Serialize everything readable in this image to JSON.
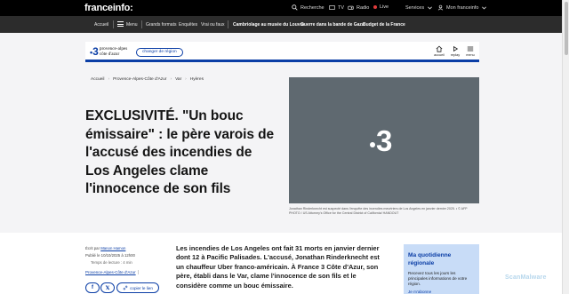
{
  "topbar": {
    "logo": "franceinfo:",
    "search_label": "Recherche",
    "tv_label": "TV",
    "radio_label": "Radio",
    "live_label": "Live",
    "services_label": "Services",
    "account_label": "Mon franceinfo"
  },
  "nav": {
    "home": "Accueil",
    "menu": "Menu",
    "items": [
      "Grands formats",
      "Enquêtes",
      "Vrai ou faux"
    ],
    "trending": [
      "Cambriolage au musée du Louvre",
      "Guerre dans la bande de Gaza",
      "Budget de la France"
    ]
  },
  "region": {
    "number": "3",
    "name_line1": "provence-alpes",
    "name_line2": "côte d'azur",
    "change_label": "changer de région",
    "icons": [
      {
        "name": "home-icon",
        "label": "accueil"
      },
      {
        "name": "replay-icon",
        "label": "replay"
      },
      {
        "name": "menu-icon",
        "label": "menu"
      }
    ]
  },
  "breadcrumb": [
    "Accueil",
    "Provence-Alpes-Côte d'Azur",
    "Var",
    "Hyères"
  ],
  "article": {
    "headline": "EXCLUSIVITÉ. \"Un bouc émissaire\" : le père varois de l'accusé des incendies de Los Angeles clame l'innocence de son fils",
    "image_caption": "Jonathan Rinderknecht est suspecté dans l'enquête des incendies meurtriers de Los Angeles en janvier dernier 2025. • © AFP PHOTO / US Attorney's Office for the Central District of California/ HANDOUT",
    "author_prefix": "Écrit par",
    "author": "Manon Hamon",
    "published": "Publié le 10/10/2025 à 12h00",
    "reading_time": "Temps de lecture : 4 min",
    "tag": "Provence-Alpes-Côte d'Azur",
    "copy_link_label": "copier le lien",
    "chapo": "Les incendies de Los Angeles ont fait 31 morts en janvier dernier dont 12 à Pacific Palisades. L'accusé, Jonathan Rinderknecht est un chauffeur Uber franco-américain. À France 3 Côte d'Azur, son père, établi dans le Var, clame l'innocence de son fils et le considère comme un bouc émissaire."
  },
  "newsletter": {
    "title": "Ma quotidienne régionale",
    "text": "Recevez tous les jours les principales informations de votre région.",
    "cta": "Je m'abonne"
  },
  "watermark": "ScanMalware",
  "colors": {
    "brand_blue": "#0b3ea6",
    "topbar_bg": "#000000",
    "navbar_bg": "#2c2c2c",
    "newsletter_bg": "#c8dcf7"
  }
}
